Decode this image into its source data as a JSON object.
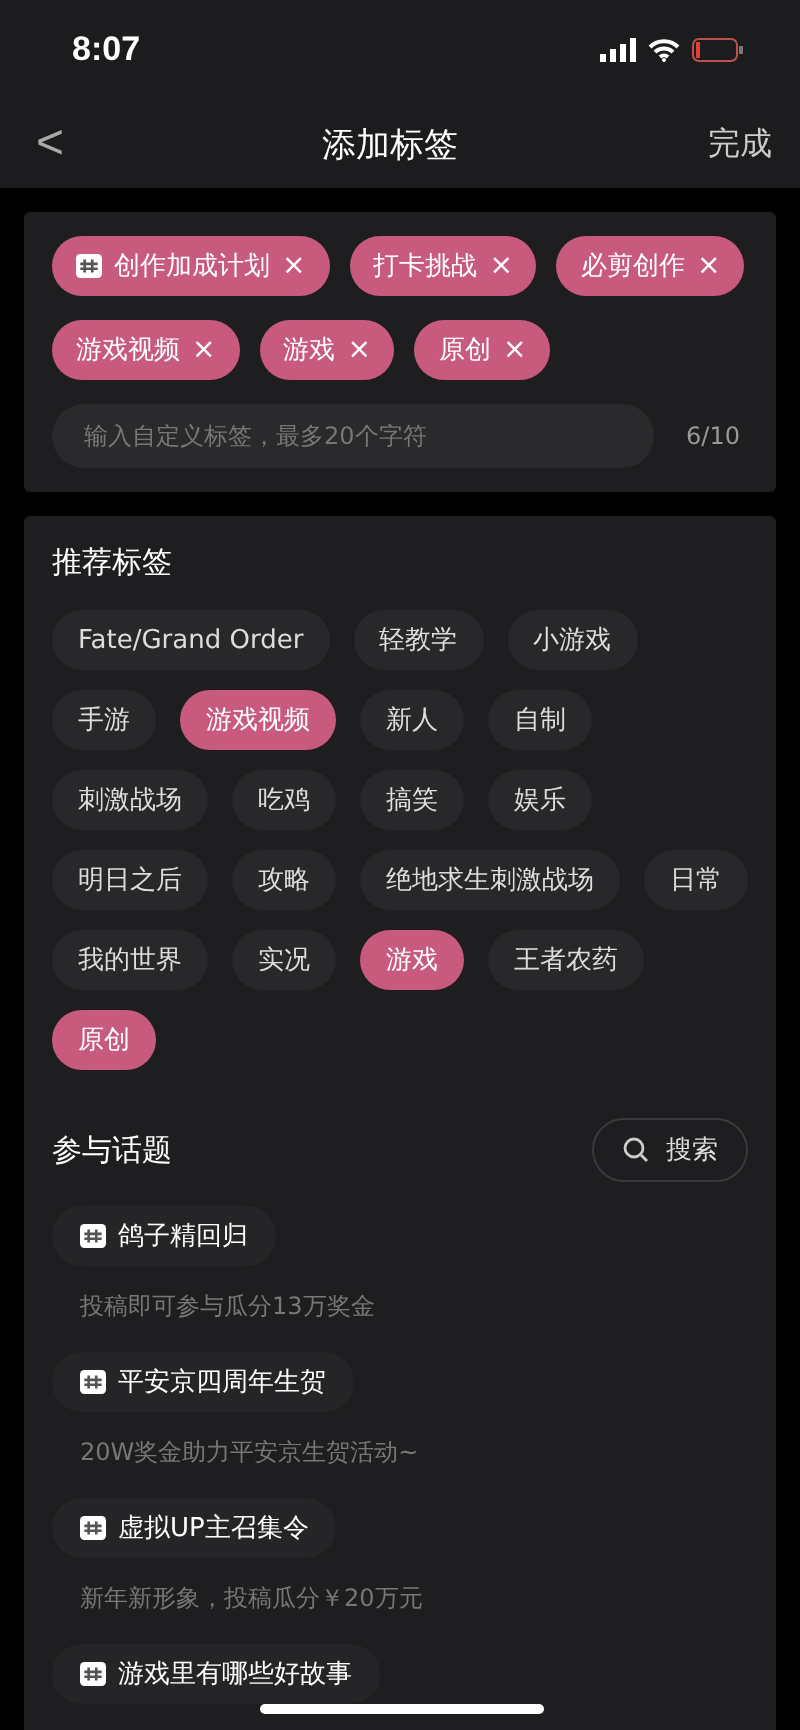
{
  "status_bar": {
    "time": "8:07"
  },
  "nav": {
    "back": "<",
    "title": "添加标签",
    "done": "完成"
  },
  "selected_tags": [
    {
      "label": "创作加成计划",
      "kind": "topic"
    },
    {
      "label": "打卡挑战",
      "kind": "tag"
    },
    {
      "label": "必剪创作",
      "kind": "tag"
    },
    {
      "label": "游戏视频",
      "kind": "tag"
    },
    {
      "label": "游戏",
      "kind": "tag"
    },
    {
      "label": "原创",
      "kind": "tag"
    }
  ],
  "remove_mark": "×",
  "custom_input": {
    "placeholder": "输入自定义标签，最多20个字符",
    "count": "6/10"
  },
  "recommended": {
    "title": "推荐标签",
    "tags": [
      {
        "label": "Fate/Grand Order",
        "selected": false
      },
      {
        "label": "轻教学",
        "selected": false
      },
      {
        "label": "小游戏",
        "selected": false
      },
      {
        "label": "手游",
        "selected": false
      },
      {
        "label": "游戏视频",
        "selected": true
      },
      {
        "label": "新人",
        "selected": false
      },
      {
        "label": "自制",
        "selected": false
      },
      {
        "label": "刺激战场",
        "selected": false
      },
      {
        "label": "吃鸡",
        "selected": false
      },
      {
        "label": "搞笑",
        "selected": false
      },
      {
        "label": "娱乐",
        "selected": false
      },
      {
        "label": "明日之后",
        "selected": false
      },
      {
        "label": "攻略",
        "selected": false
      },
      {
        "label": "绝地求生刺激战场",
        "selected": false
      },
      {
        "label": "日常",
        "selected": false
      },
      {
        "label": "我的世界",
        "selected": false
      },
      {
        "label": "实况",
        "selected": false
      },
      {
        "label": "游戏",
        "selected": true
      },
      {
        "label": "王者农药",
        "selected": false
      },
      {
        "label": "原创",
        "selected": true
      }
    ]
  },
  "topics": {
    "title": "参与话题",
    "search": "搜索",
    "items": [
      {
        "name": "鸽子精回归",
        "description": "投稿即可参与瓜分13万奖金"
      },
      {
        "name": "平安京四周年生贺",
        "description": "20W奖金助力平安京生贺活动~"
      },
      {
        "name": "虚拟UP主召集令",
        "description": "新年新形象，投稿瓜分￥20万元"
      },
      {
        "name": "游戏里有哪些好故事"
      }
    ]
  }
}
